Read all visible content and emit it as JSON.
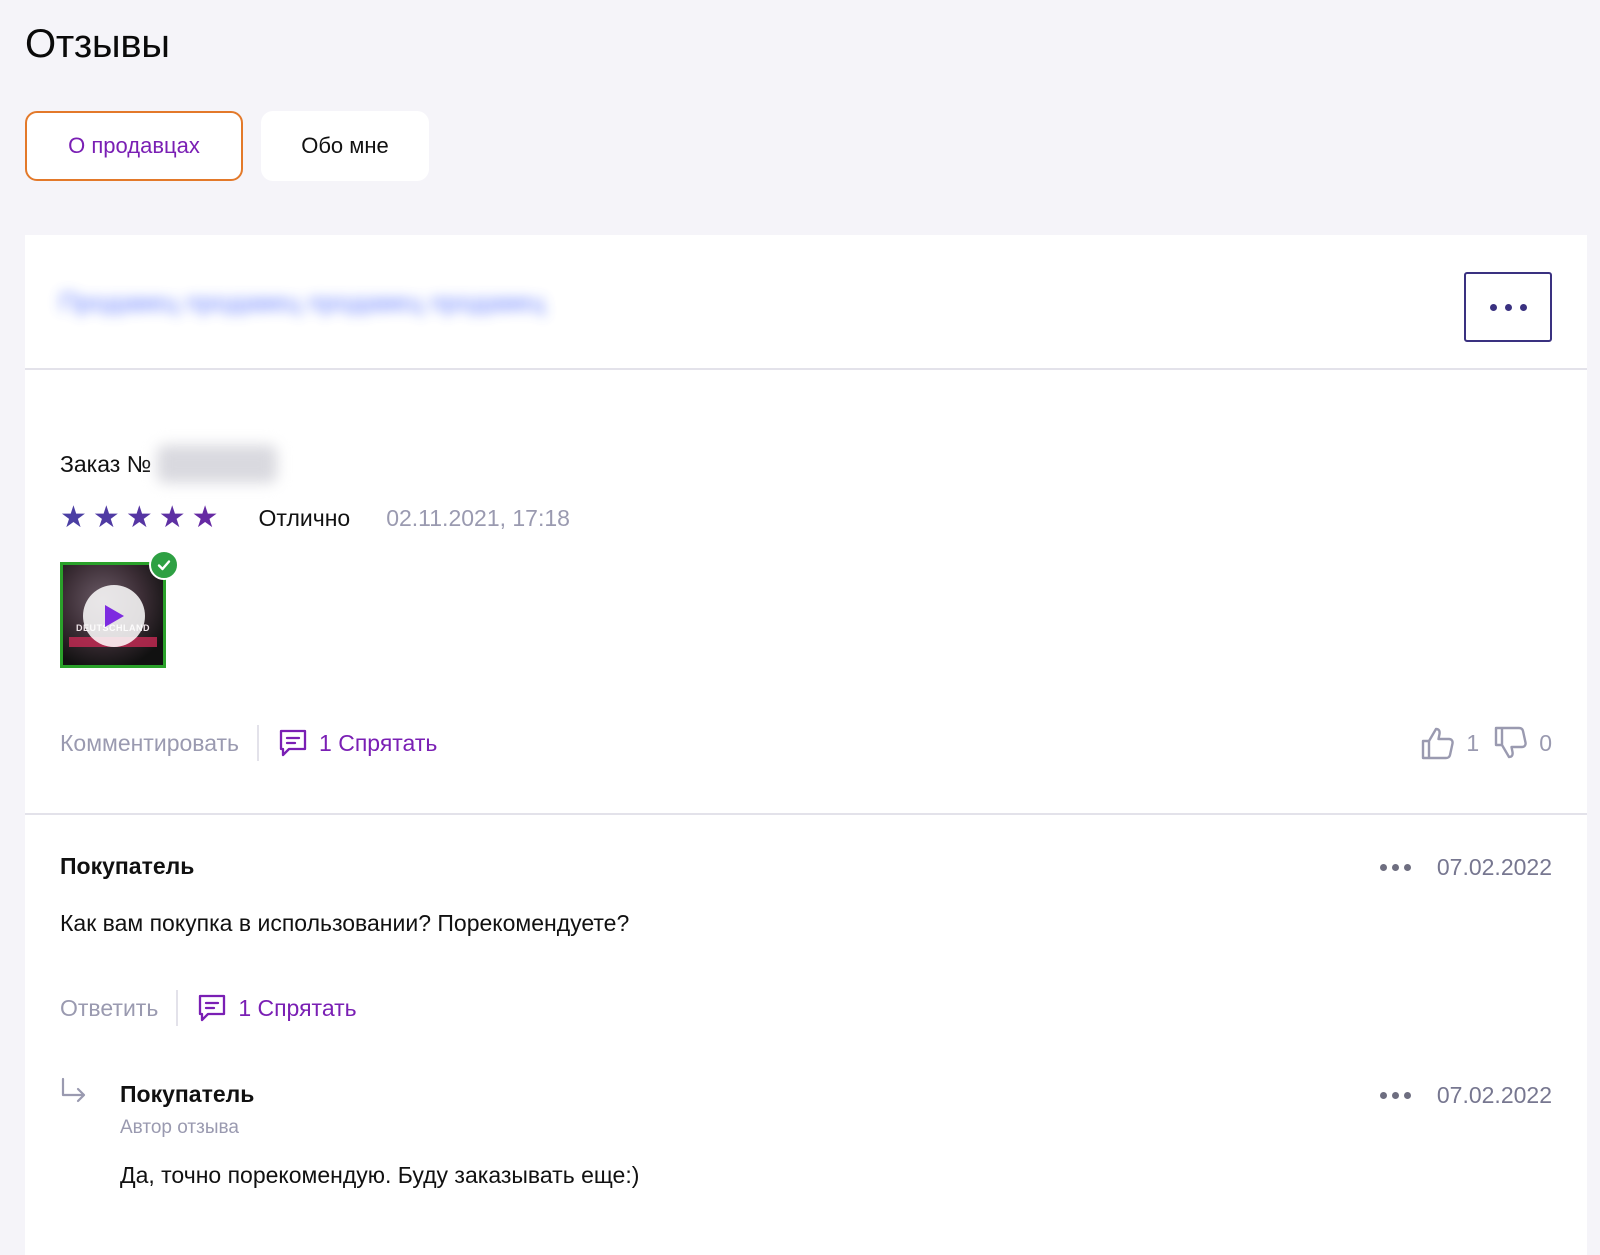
{
  "page": {
    "title": "Отзывы"
  },
  "tabs": [
    {
      "label": "О продавцах",
      "active": true
    },
    {
      "label": "Обо мне",
      "active": false
    }
  ],
  "review": {
    "seller_name": "Продавец продавец продавец продавец",
    "order_label": "Заказ №",
    "rating_stars": 5,
    "rating_max": 5,
    "rating_text": "Отлично",
    "date": "02.11.2021, 17:18",
    "media": {
      "type": "video",
      "icon": "play-icon",
      "verified": true,
      "caption": "DEUTSCHLAND"
    },
    "comment_action": "Комментировать",
    "comments_toggle": "1 Спрятать",
    "likes": "1",
    "dislikes": "0"
  },
  "comments": [
    {
      "author": "Покупатель",
      "date": "07.02.2022",
      "text": "Как вам покупка в использовании? Порекомендуете?",
      "reply_action": "Ответить",
      "replies_toggle": "1 Спрятать"
    }
  ],
  "reply": {
    "author": "Покупатель",
    "role": "Автор отзыва",
    "date": "07.02.2022",
    "text": "Да, точно порекомендую. Буду заказывать еще:)"
  },
  "colors": {
    "accent_purple": "#7a1fb4",
    "tab_active_border": "#e3792a",
    "muted_text": "#9a9ab0",
    "verified_green": "#2ea043",
    "page_bg": "#f5f4f9"
  }
}
